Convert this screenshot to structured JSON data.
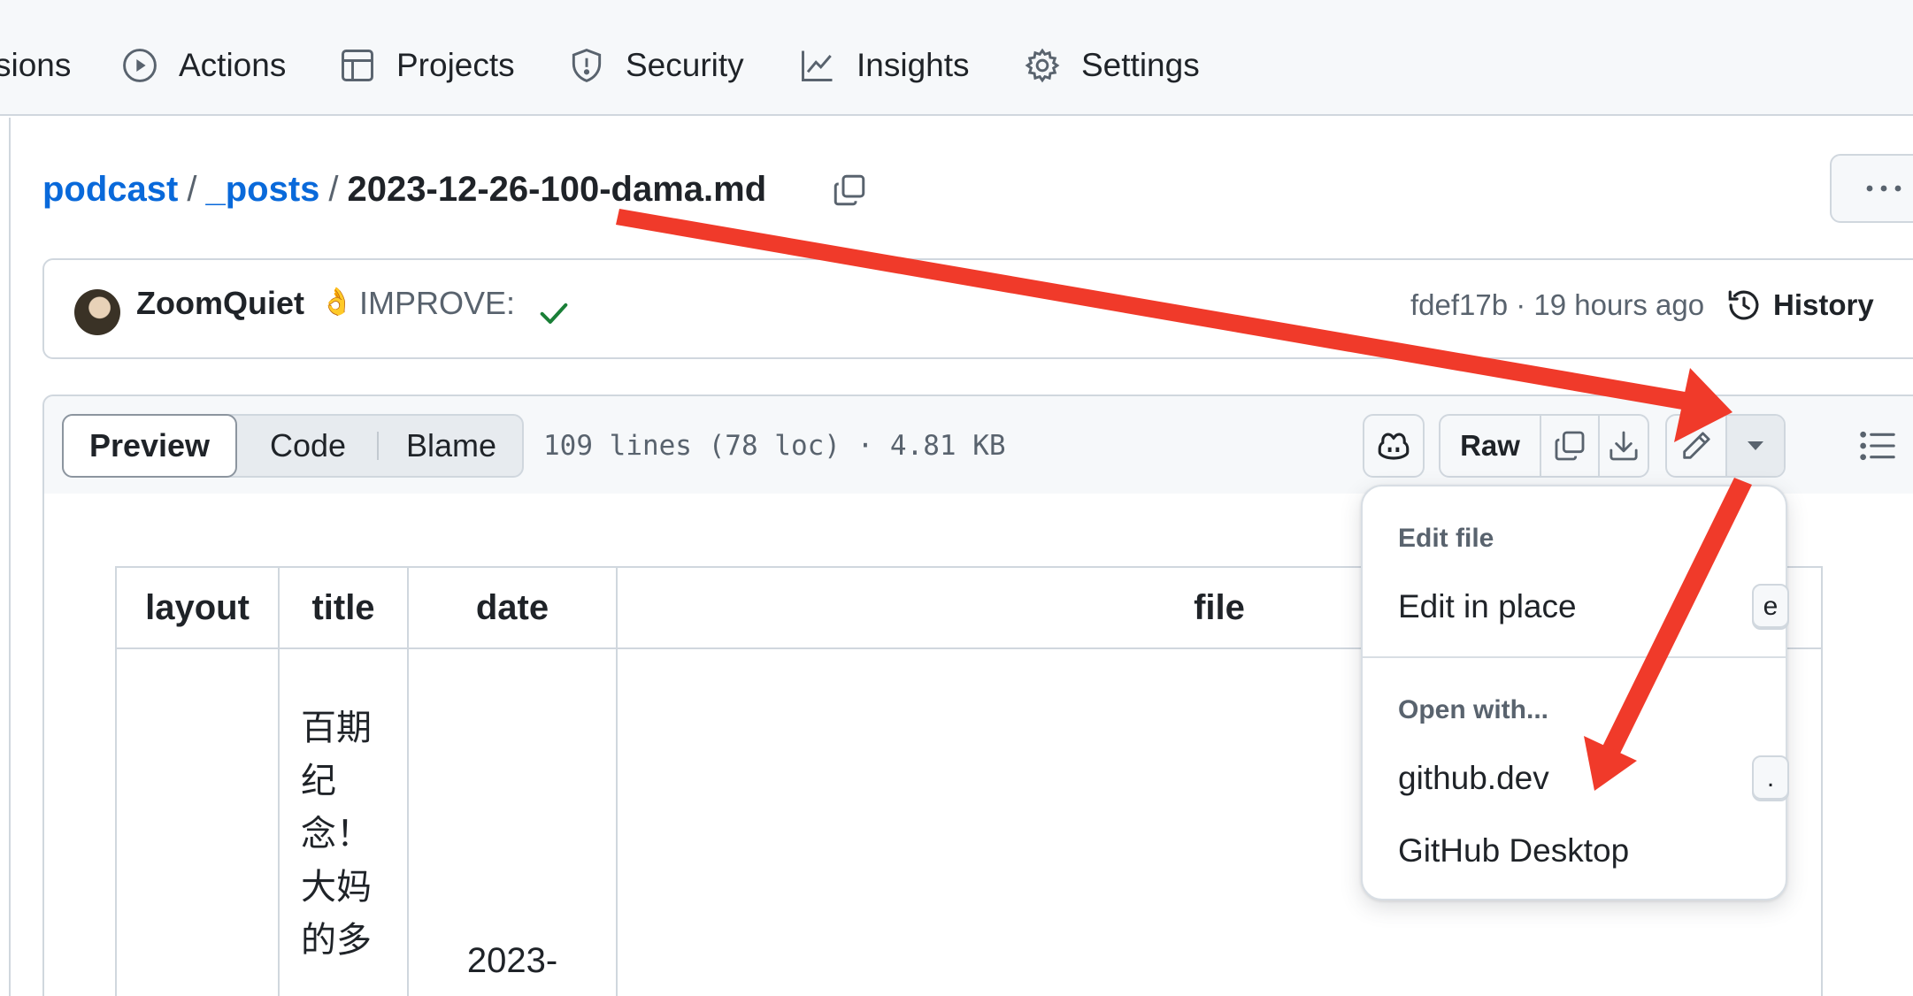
{
  "nav": {
    "items": [
      {
        "label": "sions",
        "icon": "none"
      },
      {
        "label": "Actions",
        "icon": "play-circle-icon"
      },
      {
        "label": "Projects",
        "icon": "table-icon"
      },
      {
        "label": "Security",
        "icon": "shield-icon"
      },
      {
        "label": "Insights",
        "icon": "graph-icon"
      },
      {
        "label": "Settings",
        "icon": "gear-icon"
      }
    ]
  },
  "breadcrumb": {
    "repo": "podcast",
    "folder": "_posts",
    "separator": "/",
    "file": "2023-12-26-100-dama.md"
  },
  "commit": {
    "author": "ZoomQuiet",
    "emoji": "👌",
    "message": "IMPROVE:",
    "status": "success",
    "meta": "fdef17b · 19 hours ago",
    "history_label": "History"
  },
  "file_header": {
    "tabs": [
      "Preview",
      "Code",
      "Blame"
    ],
    "active_tab": "Preview",
    "info": "109 lines (78 loc) · 4.81 KB",
    "raw_label": "Raw"
  },
  "table": {
    "headers": [
      "layout",
      "title",
      "date",
      "file"
    ],
    "row": {
      "layout": "",
      "title_lines": [
        "百期",
        "纪",
        "念！",
        "大妈",
        "的多"
      ],
      "date": "2023-"
    }
  },
  "menu": {
    "section_edit": "Edit file",
    "edit_in_place": "Edit in place",
    "edit_in_place_key": "e",
    "section_open": "Open with...",
    "github_dev": "github.dev",
    "github_dev_key": ".",
    "github_desktop": "GitHub Desktop"
  },
  "colors": {
    "link": "#0969da",
    "muted": "#59636e",
    "border": "#d0d7de",
    "success": "#1a7f37",
    "annotation_arrow": "#f03a2a"
  }
}
